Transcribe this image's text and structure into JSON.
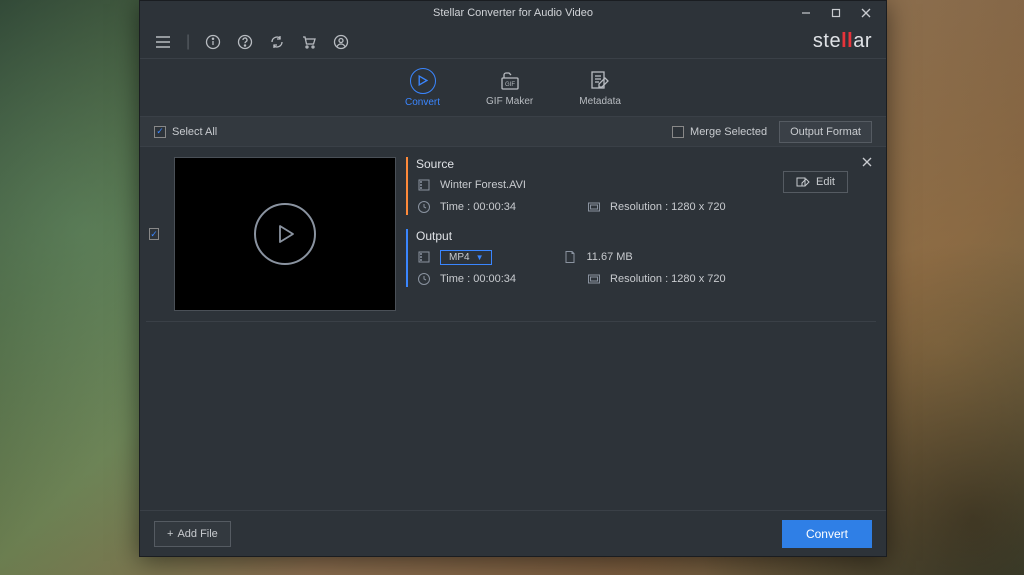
{
  "title": "Stellar Converter for Audio Video",
  "brand": {
    "pre": "ste",
    "accent": "ll",
    "post": "ar"
  },
  "modes": {
    "convert": "Convert",
    "gif": "GIF Maker",
    "meta": "Metadata"
  },
  "options": {
    "selectAll": "Select All",
    "mergeSelected": "Merge Selected",
    "outputFormat": "Output Format"
  },
  "item": {
    "source": {
      "title": "Source",
      "filename": "Winter Forest.AVI",
      "timeLabel": "Time : 00:00:34",
      "resLabel": "Resolution : 1280 x 720"
    },
    "output": {
      "title": "Output",
      "format": "MP4",
      "size": "11.67 MB",
      "timeLabel": "Time : 00:00:34",
      "resLabel": "Resolution : 1280 x 720"
    },
    "editLabel": "Edit"
  },
  "footer": {
    "addFile": "Add File",
    "convert": "Convert"
  }
}
